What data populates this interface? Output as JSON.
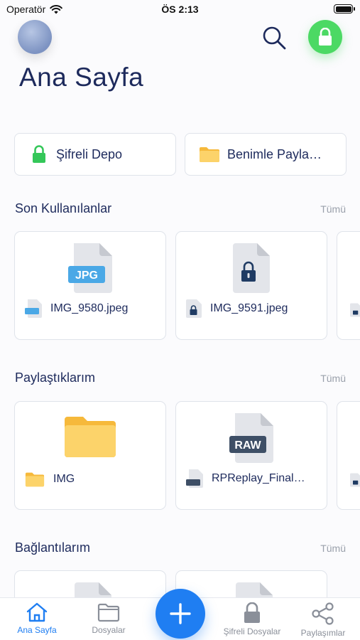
{
  "status_bar": {
    "carrier": "Operatör",
    "time": "ÖS 2:13"
  },
  "header": {
    "title": "Ana Sayfa"
  },
  "quick_access": [
    {
      "label": "Şifreli Depo",
      "icon": "lock-icon"
    },
    {
      "label": "Benimle Payla…",
      "icon": "folder-icon"
    }
  ],
  "sections": {
    "recent": {
      "title": "Son Kullanılanlar",
      "more": "Tümü",
      "items": [
        {
          "name": "IMG_9580.jpeg",
          "type": "JPG"
        },
        {
          "name": "IMG_9591.jpeg",
          "type": "locked"
        }
      ]
    },
    "shared": {
      "title": "Paylaştıklarım",
      "more": "Tümü",
      "items": [
        {
          "name": "IMG",
          "type": "folder"
        },
        {
          "name": "RPReplay_Final…",
          "type": "RAW"
        }
      ]
    },
    "links": {
      "title": "Bağlantılarım",
      "more": "Tümü"
    }
  },
  "tabbar": {
    "home": "Ana Sayfa",
    "files": "Dosyalar",
    "encrypted": "Şifreli Dosyalar",
    "shares": "Paylaşımlar"
  },
  "file_badges": {
    "jpg": "JPG",
    "raw": "RAW"
  },
  "colors": {
    "accent": "#1f7ef2",
    "lock_green": "#4cd964",
    "folder_yellow": "#fcd36a",
    "text": "#1d2a5c"
  }
}
